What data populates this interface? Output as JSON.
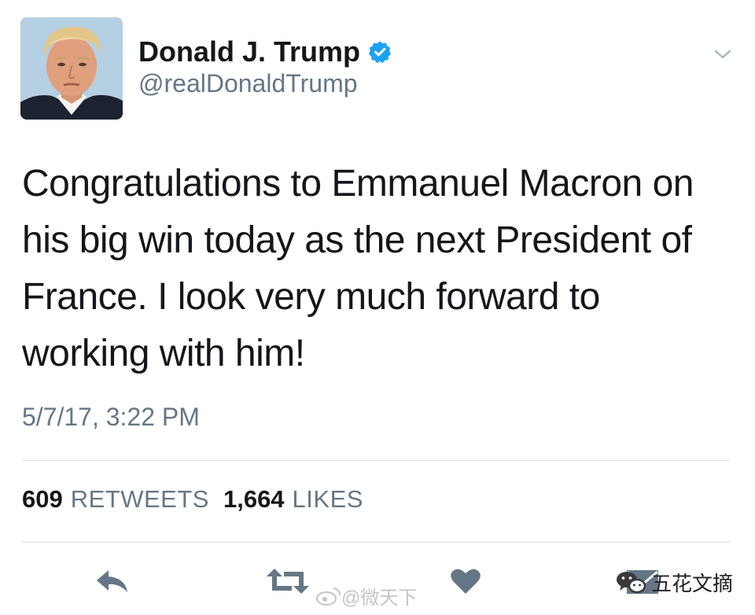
{
  "user": {
    "display_name": "Donald J. Trump",
    "handle": "@realDonaldTrump",
    "verified": true,
    "avatar_icon": "profile-photo"
  },
  "tweet": {
    "text": "Congratulations to Emmanuel Macron on his big win today as the next President of France. I look very much forward to working with him!",
    "timestamp": "5/7/17, 3:22 PM"
  },
  "stats": {
    "retweets_count": "609",
    "retweets_label": "RETWEETS",
    "likes_count": "1,664",
    "likes_label": "LIKES"
  },
  "actions": [
    {
      "icon": "reply-icon"
    },
    {
      "icon": "retweet-icon"
    },
    {
      "icon": "heart-icon"
    },
    {
      "icon": "direct-message-icon"
    }
  ],
  "watermarks": {
    "weibo_text": "@微天下",
    "wechat_text": "五花文摘"
  },
  "colors": {
    "text_primary": "#14171a",
    "text_secondary": "#657786",
    "verified_blue": "#1da1f2",
    "icon_gray": "#657786",
    "divider": "#d6dde3"
  }
}
